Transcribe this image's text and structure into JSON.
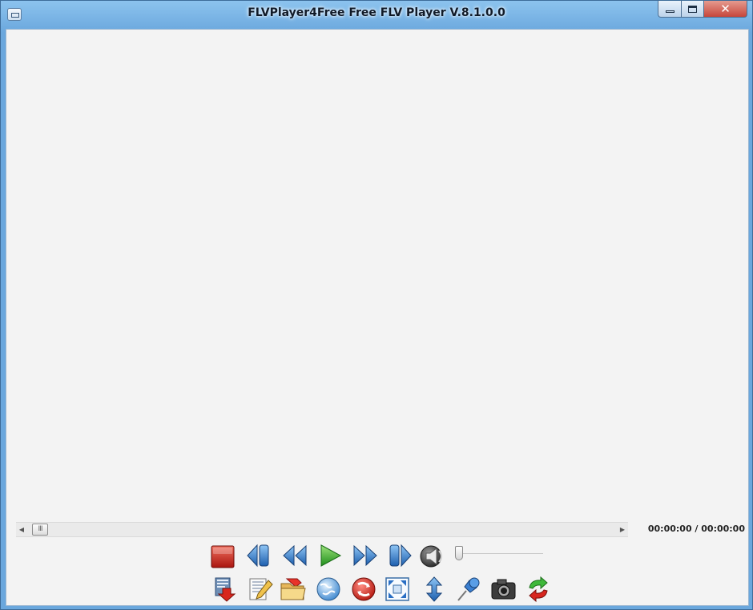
{
  "window": {
    "title": "FLVPlayer4Free Free FLV Player V.8.1.0.0",
    "close_glyph": "✕"
  },
  "player": {
    "time_display": "00:00:00 / 00:00:00",
    "volume_fraction": 0.0,
    "seek_fraction": 0.0,
    "seek_thumb_glyph": "III"
  },
  "icons": {
    "row1": [
      "stop-icon",
      "previous-icon",
      "rewind-icon",
      "play-icon",
      "fast-forward-icon",
      "next-icon",
      "volume-icon"
    ],
    "row2": [
      "download-icon",
      "edit-icon",
      "open-folder-icon",
      "globe-icon",
      "convert-icon",
      "fullscreen-icon",
      "resize-vertical-icon",
      "pin-icon",
      "camera-icon",
      "refresh-icon"
    ]
  },
  "colors": {
    "stop": "#c8271f",
    "transport_blue": "#2a6fc4",
    "play_green": "#2fae2c"
  }
}
